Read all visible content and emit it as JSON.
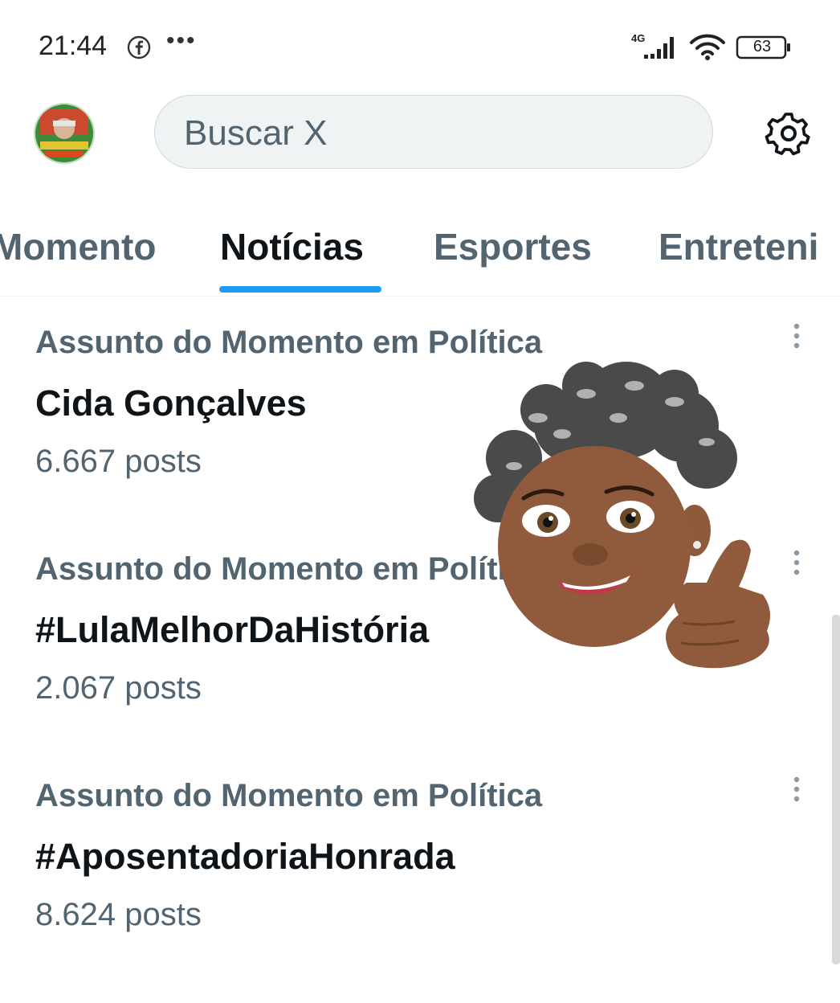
{
  "status_bar": {
    "time": "21:44",
    "network": "4G",
    "battery": "63",
    "icons": [
      "facebook-icon",
      "more-dots-icon",
      "signal-icon",
      "wifi-icon",
      "battery-icon"
    ]
  },
  "header": {
    "search_placeholder": "Buscar X",
    "settings_icon": "gear-icon"
  },
  "tabs": [
    {
      "label": "Momento"
    },
    {
      "label": "Notícias",
      "active": true
    },
    {
      "label": "Esportes"
    },
    {
      "label": "Entreteni"
    }
  ],
  "trends": [
    {
      "context": "Assunto do Momento em Política",
      "title": "Cida Gonçalves",
      "count": "6.667 posts"
    },
    {
      "context": "Assunto do Momento em Política",
      "title": "#LulaMelhorDaHistória",
      "count": "2.067 posts"
    },
    {
      "context": "Assunto do Momento em Política",
      "title": "#AposentadoriaHonrada",
      "count": "8.624 posts"
    }
  ],
  "colors": {
    "accent": "#1d9bf0",
    "text_primary": "#0f1419",
    "text_secondary": "#536471",
    "search_bg": "#eff3f4"
  }
}
